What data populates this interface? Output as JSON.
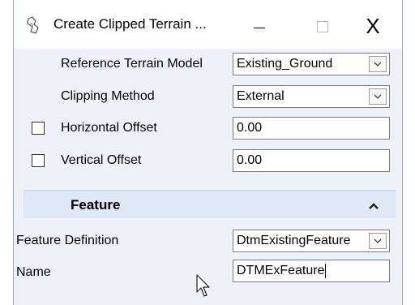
{
  "window": {
    "title": "Create Clipped Terrain ...",
    "minimize_glyph": "—",
    "close_glyph": "X"
  },
  "fields": {
    "reference_terrain_model": {
      "label": "Reference Terrain Model",
      "value": "Existing_Ground"
    },
    "clipping_method": {
      "label": "Clipping Method",
      "value": "External"
    },
    "horizontal_offset": {
      "label": "Horizontal Offset",
      "value": "0.00",
      "checked": false
    },
    "vertical_offset": {
      "label": "Vertical Offset",
      "value": "0.00",
      "checked": false
    }
  },
  "feature_section": {
    "title": "Feature",
    "expanded": true,
    "feature_definition": {
      "label": "Feature Definition",
      "value": "DtmExistingFeature"
    },
    "name": {
      "label": "Name",
      "value": "DTMExFeature"
    }
  },
  "colors": {
    "panel_background": "#eef2f8",
    "section_header": "#dfe8f6"
  },
  "icons": [
    "terrain-app-icon",
    "minimize-icon",
    "maximize-icon",
    "close-icon",
    "chevron-down-icon",
    "chevron-up-icon",
    "mouse-pointer-icon"
  ]
}
